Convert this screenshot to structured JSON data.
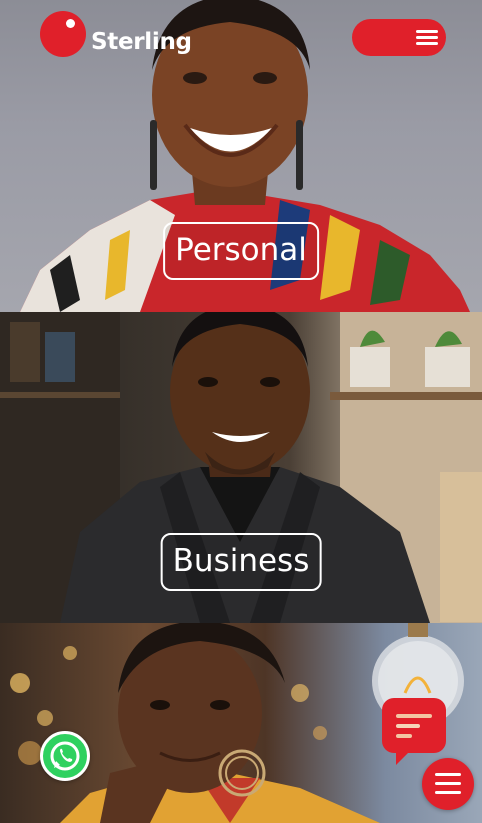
{
  "header": {
    "brand_name": "Sterling",
    "menu_icon": "hamburger-icon",
    "brand_color": "#e0202a"
  },
  "panels": [
    {
      "id": "personal",
      "label": "Personal"
    },
    {
      "id": "business",
      "label": "Business"
    },
    {
      "id": "third",
      "label": ""
    }
  ],
  "floating": {
    "whatsapp_icon": "whatsapp-icon",
    "chat_icon": "chat-bubble-icon",
    "menu_icon": "hamburger-icon"
  }
}
